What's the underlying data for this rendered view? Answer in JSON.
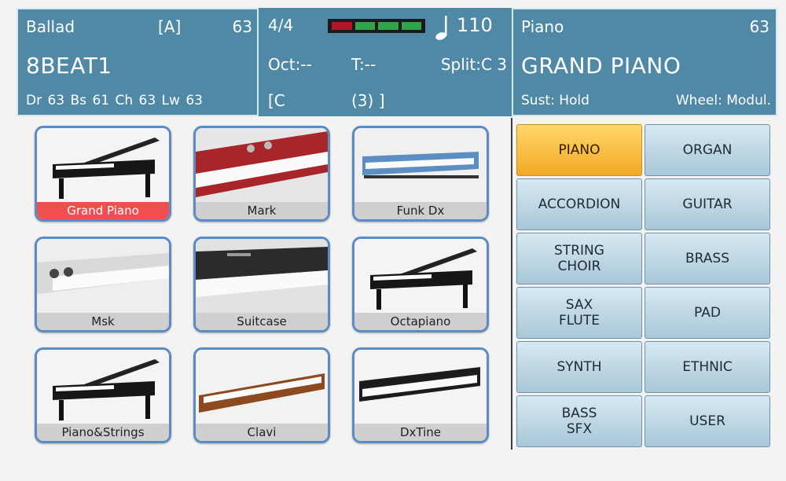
{
  "style_panel": {
    "style_name": "Ballad",
    "variation": "[A]",
    "style_bank": "63",
    "style_title": "8BEAT1",
    "parts": "Dr 63  Bs 61  Ch 63  Lw 63"
  },
  "arranger_panel": {
    "time_signature": "4/4",
    "tempo": "110",
    "octave": "Oct:--",
    "transpose": "T:--",
    "split": "Split:C 3",
    "chord_open": "[C",
    "chord_close": "(3) ]",
    "beat_segments": [
      {
        "color": "#b3152b"
      },
      {
        "color": "#2ea54a"
      },
      {
        "color": "#2ea54a"
      },
      {
        "color": "#2ea54a"
      }
    ]
  },
  "voice_panel": {
    "family": "Piano",
    "bank": "63",
    "voice_name": "GRAND PIANO",
    "sustain": "Sust: Hold",
    "wheel": "Wheel: Modul."
  },
  "voices": [
    {
      "label": "Grand Piano",
      "icon": "grand-piano-icon",
      "selected": true
    },
    {
      "label": "Mark",
      "icon": "electric-piano-icon",
      "selected": false
    },
    {
      "label": "Funk Dx",
      "icon": "keyboard-icon",
      "selected": false
    },
    {
      "label": "Msk",
      "icon": "stage-piano-icon",
      "selected": false
    },
    {
      "label": "Suitcase",
      "icon": "suitcase-piano-icon",
      "selected": false
    },
    {
      "label": "Octapiano",
      "icon": "grand-piano-icon",
      "selected": false
    },
    {
      "label": "Piano&Strings",
      "icon": "grand-piano-icon",
      "selected": false
    },
    {
      "label": "Clavi",
      "icon": "clavinet-icon",
      "selected": false
    },
    {
      "label": "DxTine",
      "icon": "synth-keyboard-icon",
      "selected": false
    }
  ],
  "categories": [
    {
      "line1": "PIANO",
      "line2": "",
      "active": true
    },
    {
      "line1": "ORGAN",
      "line2": "",
      "active": false
    },
    {
      "line1": "ACCORDION",
      "line2": "",
      "active": false
    },
    {
      "line1": "GUITAR",
      "line2": "",
      "active": false
    },
    {
      "line1": "STRING",
      "line2": "CHOIR",
      "active": false
    },
    {
      "line1": "BRASS",
      "line2": "",
      "active": false
    },
    {
      "line1": "SAX",
      "line2": "FLUTE",
      "active": false
    },
    {
      "line1": "PAD",
      "line2": "",
      "active": false
    },
    {
      "line1": "SYNTH",
      "line2": "",
      "active": false
    },
    {
      "line1": "ETHNIC",
      "line2": "",
      "active": false
    },
    {
      "line1": "BASS",
      "line2": "SFX",
      "active": false
    },
    {
      "line1": "USER",
      "line2": "",
      "active": false
    }
  ],
  "colors": {
    "header_bg": "#4f89a6",
    "selected_label": "#f04f50",
    "active_category": "#f2a923"
  }
}
